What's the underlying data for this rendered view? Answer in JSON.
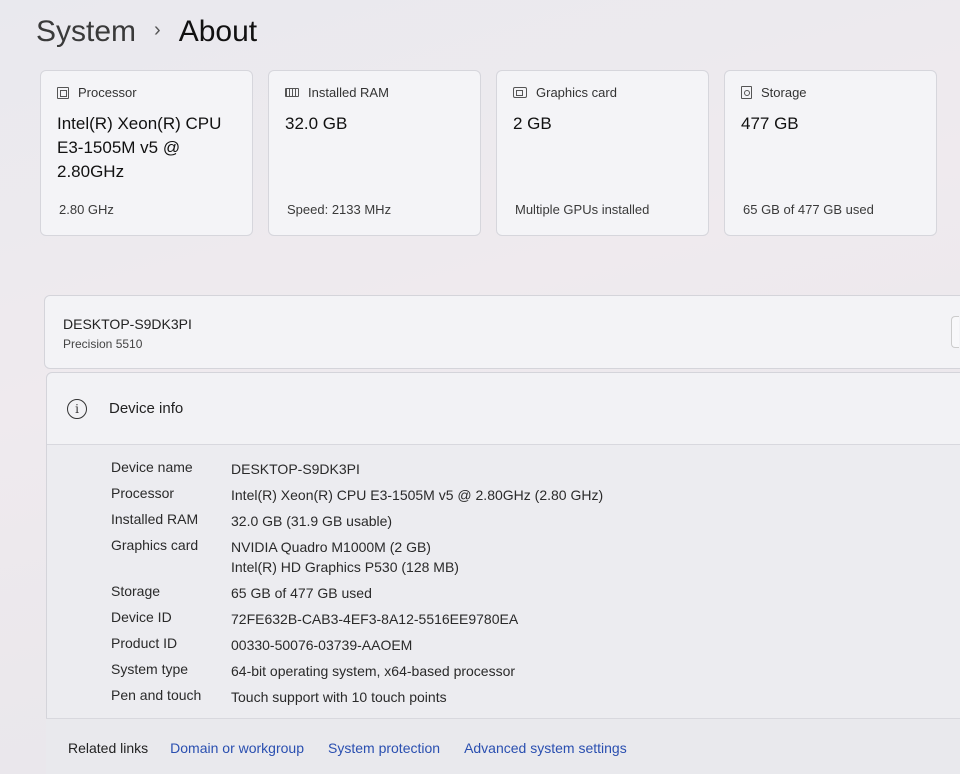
{
  "breadcrumb": {
    "parent": "System",
    "separator": "›",
    "current": "About"
  },
  "cards": [
    {
      "icon": "processor-icon",
      "label": "Processor",
      "value": "Intel(R) Xeon(R) CPU E3-1505M v5 @ 2.80GHz",
      "sub": "2.80 GHz"
    },
    {
      "icon": "ram-icon",
      "label": "Installed RAM",
      "value": "32.0 GB",
      "sub": "Speed: 2133 MHz"
    },
    {
      "icon": "graphics-card-icon",
      "label": "Graphics card",
      "value": "2 GB",
      "sub": "Multiple GPUs installed"
    },
    {
      "icon": "storage-icon",
      "label": "Storage",
      "value": "477 GB",
      "sub": "65 GB of 477 GB used"
    }
  ],
  "device": {
    "name": "DESKTOP-S9DK3PI",
    "model": "Precision 5510"
  },
  "device_info": {
    "title": "Device info",
    "rows": [
      {
        "label": "Device name",
        "value": "DESKTOP-S9DK3PI"
      },
      {
        "label": "Processor",
        "value": "Intel(R) Xeon(R) CPU E3-1505M v5 @ 2.80GHz (2.80 GHz)"
      },
      {
        "label": "Installed RAM",
        "value": "32.0 GB (31.9 GB usable)"
      },
      {
        "label": "Graphics card",
        "value": "NVIDIA Quadro M1000M (2 GB)",
        "value2": "Intel(R) HD Graphics P530 (128 MB)"
      },
      {
        "label": "Storage",
        "value": "65 GB of 477 GB used"
      },
      {
        "label": "Device ID",
        "value": "72FE632B-CAB3-4EF3-8A12-5516EE9780EA"
      },
      {
        "label": "Product ID",
        "value": "00330-50076-03739-AAOEM"
      },
      {
        "label": "System type",
        "value": "64-bit operating system, x64-based processor"
      },
      {
        "label": "Pen and touch",
        "value": "Touch support with 10 touch points"
      }
    ]
  },
  "related_links": {
    "label": "Related links",
    "links": [
      "Domain or workgroup",
      "System protection",
      "Advanced system settings"
    ]
  },
  "colors": {
    "link": "#2a4fb0",
    "card_bg": "#f4f4f7"
  }
}
